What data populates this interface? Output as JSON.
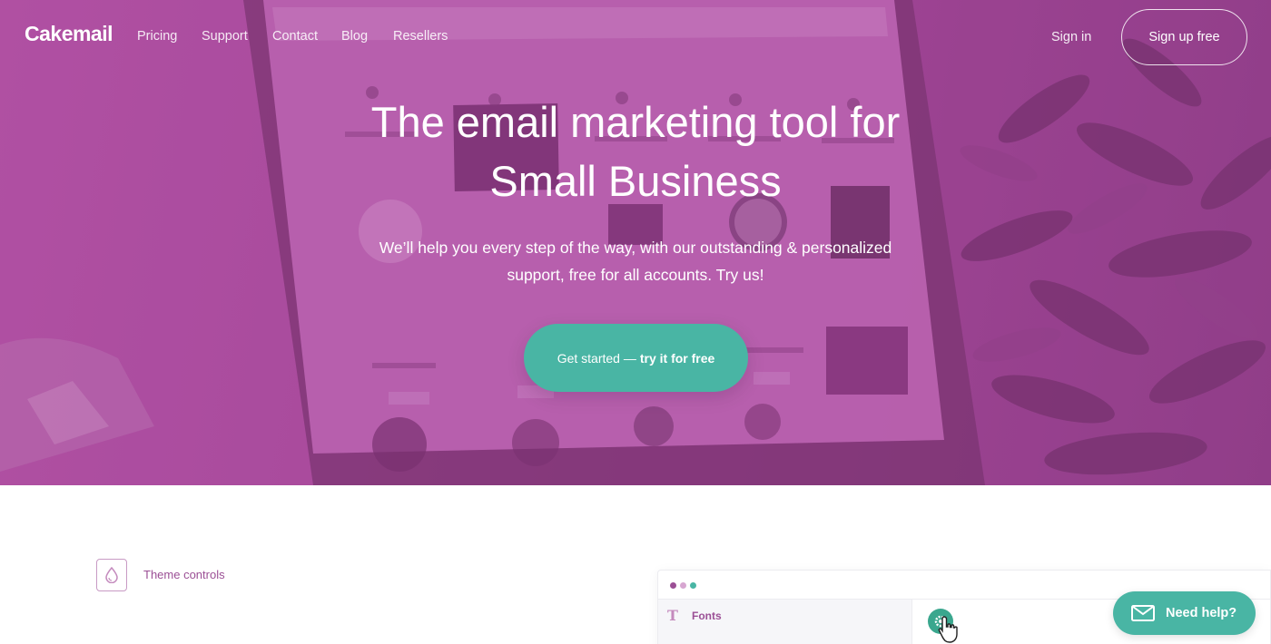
{
  "brand": {
    "logo": "Cakemail"
  },
  "nav": {
    "links": [
      "Pricing",
      "Support",
      "Contact",
      "Blog",
      "Resellers"
    ],
    "sign_in": "Sign in",
    "sign_up": "Sign up free"
  },
  "hero": {
    "headline_line1": "The email marketing tool for",
    "headline_line2": "Small Business",
    "subtext_line1": "We’ll help you every step of the way, with our outstanding & personalized",
    "subtext_line2": "support, free for all accounts. Try us!",
    "cta_prefix": "Get started —",
    "cta_bold": "try it for free"
  },
  "features": {
    "theme_controls_label": "Theme controls",
    "fonts_label": "Fonts"
  },
  "help_widget": {
    "label": "Need help?"
  },
  "colors": {
    "brand_purple": "#a94a9c",
    "accent_teal": "#49b5a4",
    "label_purple": "#9b4f95"
  }
}
